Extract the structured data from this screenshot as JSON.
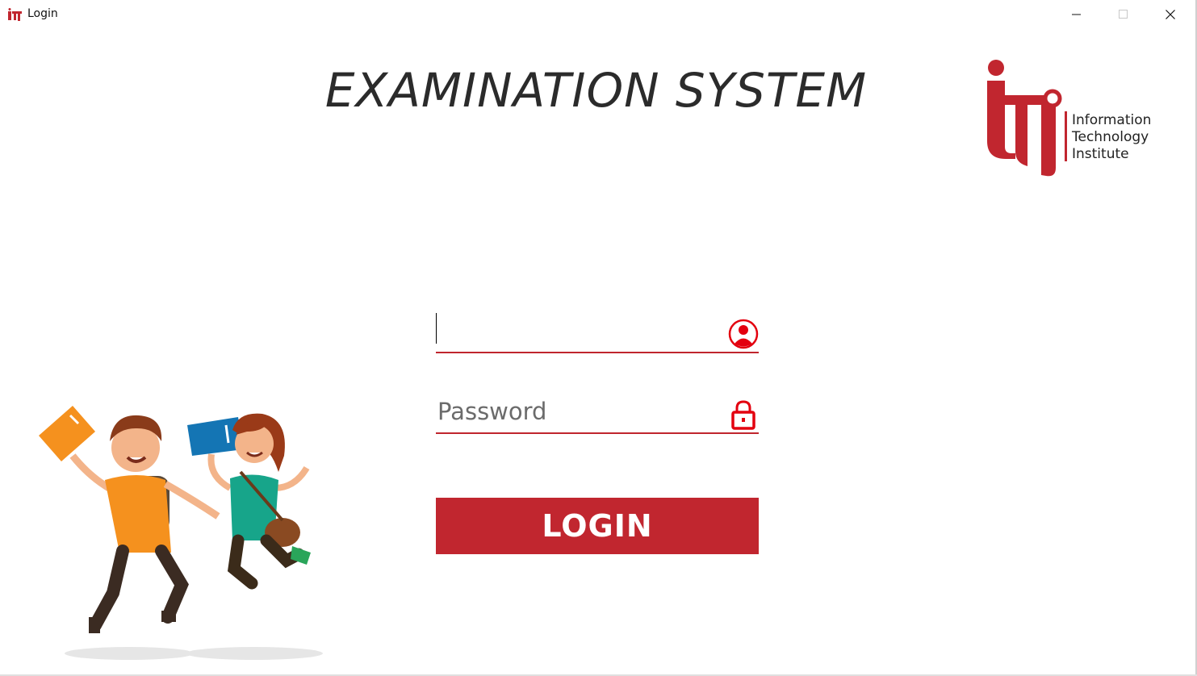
{
  "window": {
    "title": "Login",
    "controls": [
      "minimize",
      "maximize",
      "close"
    ]
  },
  "header": {
    "title": "EXAMINATION SYSTEM"
  },
  "logo": {
    "mark": "iti",
    "line1": "Information",
    "line2": "Technology",
    "line3": "Institute",
    "color": "#c1262f"
  },
  "form": {
    "username": {
      "value": "",
      "placeholder": "",
      "icon": "user-icon"
    },
    "password": {
      "value": "",
      "placeholder": "Password",
      "icon": "lock-icon"
    },
    "login_label": "LOGIN"
  },
  "colors": {
    "accent": "#c1262f",
    "icon_red": "#e3000f",
    "text_dark": "#2b2b2b"
  }
}
